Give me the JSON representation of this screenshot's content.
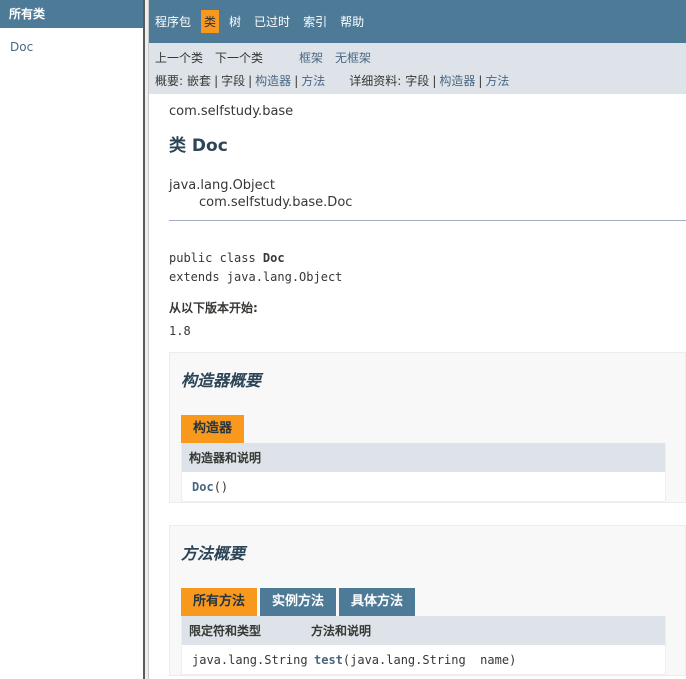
{
  "left": {
    "header": "所有类",
    "classes": [
      "Doc"
    ]
  },
  "topnav": {
    "items": [
      "程序包",
      "类",
      "树",
      "已过时",
      "索引",
      "帮助"
    ],
    "active": "类"
  },
  "subnav": {
    "prev_class": "上一个类",
    "next_class": "下一个类",
    "frames": "框架",
    "no_frames": "无框架",
    "summary_label": "概要:",
    "summary_items": [
      "嵌套",
      "字段",
      "构造器",
      "方法"
    ],
    "detail_label": "详细资料:",
    "detail_items": [
      "字段",
      "构造器",
      "方法"
    ]
  },
  "content": {
    "package": "com.selfstudy.base",
    "title": "类 Doc",
    "inherit_parent": "java.lang.Object",
    "inherit_child": "com.selfstudy.base.Doc",
    "sig_prefix": "public class ",
    "sig_name": "Doc",
    "sig_extends": "extends java.lang.Object",
    "since_label": "从以下版本开始:",
    "since_value": "1.8"
  },
  "constructor_summary": {
    "heading": "构造器概要",
    "tab": "构造器",
    "column": "构造器和说明",
    "rows": [
      {
        "name": "Doc",
        "params": "()"
      }
    ]
  },
  "method_summary": {
    "heading": "方法概要",
    "tabs": [
      "所有方法",
      "实例方法",
      "具体方法"
    ],
    "columns": [
      "限定符和类型",
      "方法和说明"
    ],
    "rows": [
      {
        "type": "java.lang.String",
        "name": "test",
        "params": "(java.lang.String  name)"
      }
    ]
  },
  "colors": {
    "nav_bg": "#4d7a97",
    "active_tab": "#f8981d",
    "subnav_bg": "#dee3e9",
    "link": "#4a6782"
  }
}
